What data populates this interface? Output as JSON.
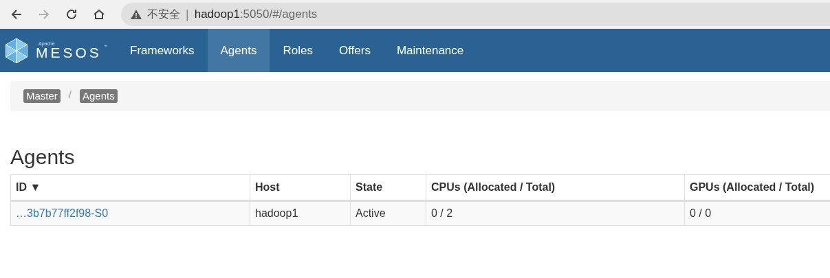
{
  "browser": {
    "security_label": "不安全",
    "separator": "|",
    "url_host": "hadoop1",
    "url_rest": ":5050/#/agents",
    "forward_disabled": true
  },
  "logo": {
    "small": "Apache",
    "name": "MESOS",
    "mark": "™"
  },
  "nav": [
    {
      "label": "Frameworks",
      "selected": false
    },
    {
      "label": "Agents",
      "selected": true
    },
    {
      "label": "Roles",
      "selected": false
    },
    {
      "label": "Offers",
      "selected": false
    },
    {
      "label": "Maintenance",
      "selected": false
    }
  ],
  "breadcrumb": {
    "items": [
      "Master",
      "Agents"
    ],
    "separator": "/"
  },
  "heading": "Agents",
  "table": {
    "columns": [
      {
        "label": "ID",
        "sort": "▼"
      },
      {
        "label": "Host"
      },
      {
        "label": "State"
      },
      {
        "label": "CPUs (Allocated / Total)"
      },
      {
        "label": "GPUs (Allocated / Total)"
      }
    ],
    "rows": [
      {
        "id": "…3b7b77ff2f98-S0",
        "host": "hadoop1",
        "state": "Active",
        "cpus": "0 / 2",
        "gpus": "0 / 0"
      }
    ]
  }
}
